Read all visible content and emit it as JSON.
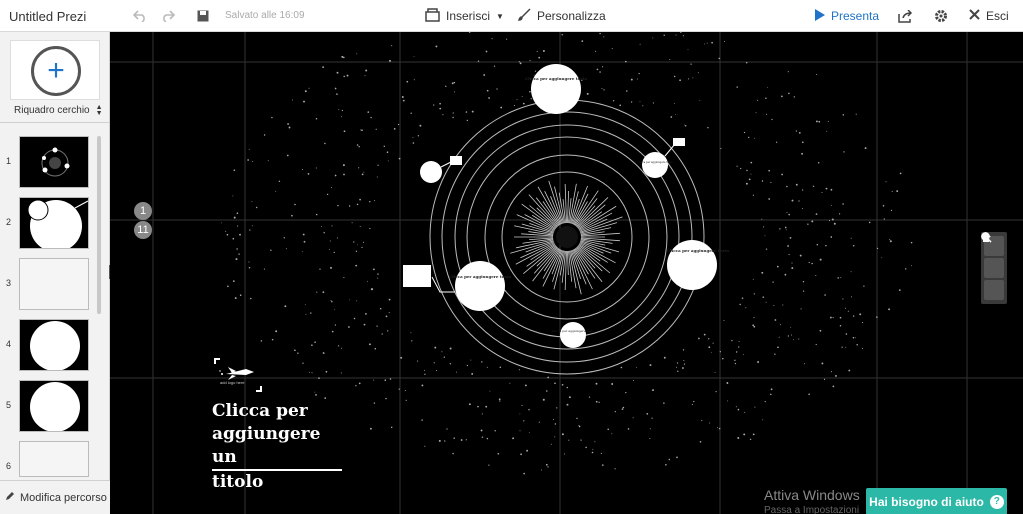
{
  "app": {
    "title": "Untitled Prezi"
  },
  "toolbar": {
    "saved_status": "Salvato alle 16:09",
    "insert_label": "Inserisci",
    "customize_label": "Personalizza",
    "present_label": "Presenta",
    "exit_label": "Esci",
    "accent_color": "#1f73c9"
  },
  "sidebar": {
    "frame_type": "Riquadro cerchio",
    "thumbnails": [
      {
        "number": "1"
      },
      {
        "number": "2"
      },
      {
        "number": "3"
      },
      {
        "number": "4"
      },
      {
        "number": "5"
      },
      {
        "number": "6"
      }
    ],
    "edit_path_label": "Modifica percorso"
  },
  "canvas": {
    "path_badges": [
      "1",
      "11"
    ],
    "title_text_line1": "Clicca per",
    "title_text_line2": "aggiungere un",
    "title_text_line3": "titolo",
    "logo_caption": "add logo here",
    "planet_labels": [
      "Clicca per aggiungere testo",
      "Clicca per aggiungere testo",
      "Clicca per aggiungere testo"
    ],
    "side_planet_label": "Clicca per aggiungere testo",
    "small_planet_label": "Clicca per aggiungere testo"
  },
  "overlay": {
    "windows_activate": "Attiva Windows",
    "windows_activate_sub": "Passa a Impostazioni",
    "help_label": "Hai bisogno di aiuto",
    "help_color": "#2cb8a6"
  }
}
